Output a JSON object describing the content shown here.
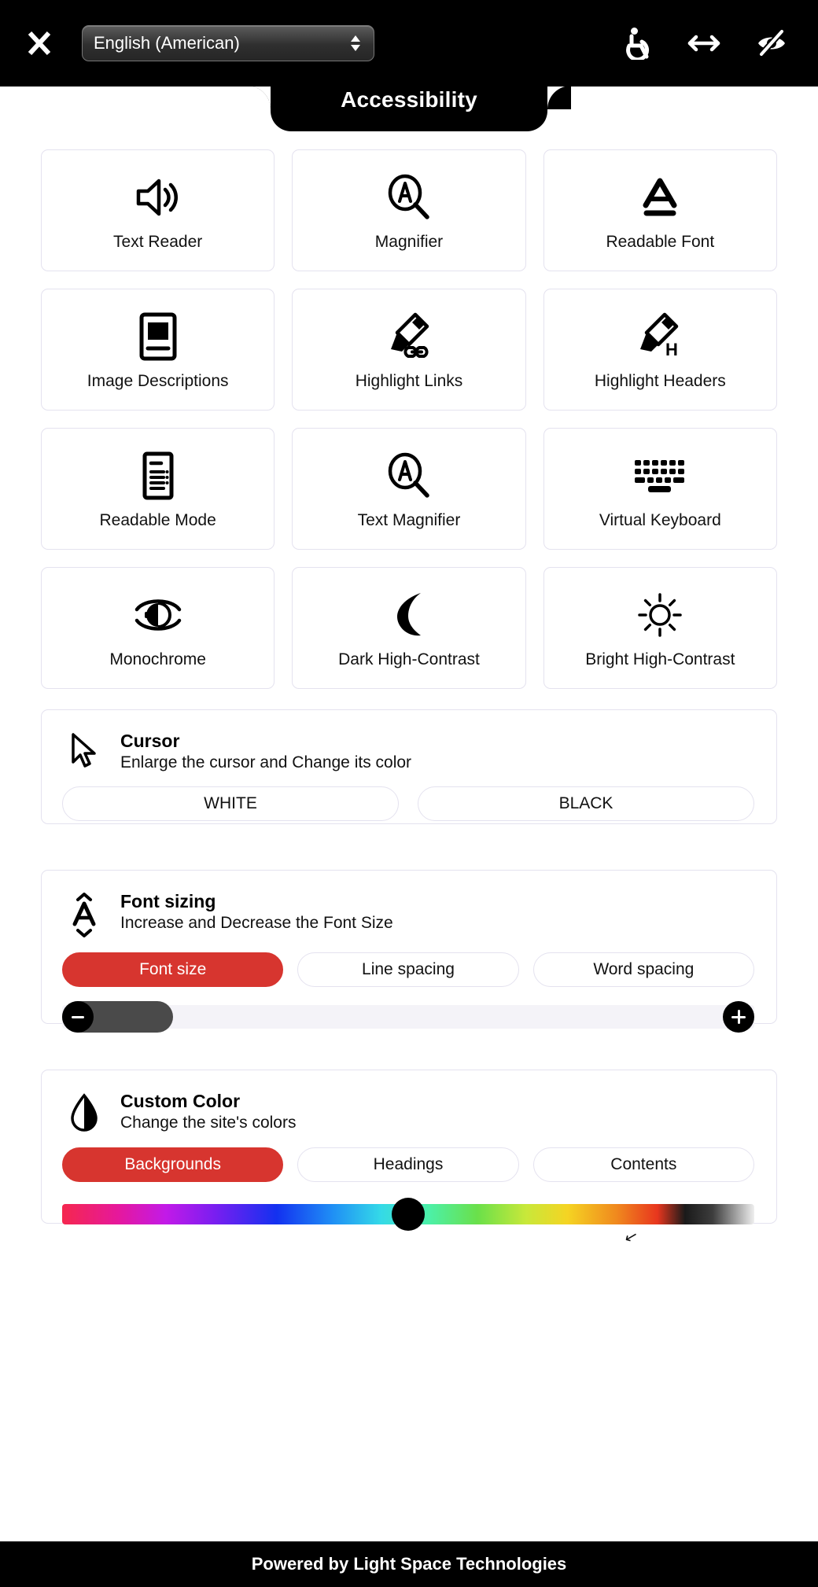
{
  "header": {
    "close_icon": "close-x-icon",
    "language_value": "English (American)",
    "actions": [
      {
        "name": "accessibility-wheelchair-icon"
      },
      {
        "name": "resize-horizontal-icon"
      },
      {
        "name": "hide-eye-off-icon"
      }
    ]
  },
  "title": "Accessibility",
  "tiles": [
    {
      "label": "Text Reader",
      "icon": "speaker-volume-icon"
    },
    {
      "label": "Magnifier",
      "icon": "magnifier-a-icon"
    },
    {
      "label": "Readable Font",
      "icon": "letter-a-underline-icon"
    },
    {
      "label": "Image Descriptions",
      "icon": "image-frame-icon"
    },
    {
      "label": "Highlight Links",
      "icon": "highlighter-link-icon"
    },
    {
      "label": "Highlight Headers",
      "icon": "highlighter-h-icon"
    },
    {
      "label": "Readable Mode",
      "icon": "document-lines-icon"
    },
    {
      "label": "Text Magnifier",
      "icon": "magnifier-a-icon"
    },
    {
      "label": "Virtual Keyboard",
      "icon": "keyboard-icon"
    },
    {
      "label": "Monochrome",
      "icon": "eye-half-icon"
    },
    {
      "label": "Dark High-Contrast",
      "icon": "moon-icon"
    },
    {
      "label": "Bright High-Contrast",
      "icon": "sun-icon"
    }
  ],
  "cursor_panel": {
    "icon": "cursor-arrow-icon",
    "title": "Cursor",
    "subtitle": "Enlarge the cursor and Change its color",
    "buttons": [
      {
        "label": "WHITE",
        "active": false
      },
      {
        "label": "BLACK",
        "active": false
      }
    ]
  },
  "font_panel": {
    "icon": "font-sizing-a-icon",
    "title": "Font sizing",
    "subtitle": "Increase and Decrease the Font Size",
    "tabs": [
      {
        "label": "Font size",
        "active": true
      },
      {
        "label": "Line spacing",
        "active": false
      },
      {
        "label": "Word spacing",
        "active": false
      }
    ],
    "slider": {
      "decrease_icon": "minus-icon",
      "increase_icon": "plus-icon",
      "fill_percent": 16
    }
  },
  "color_panel": {
    "icon": "color-drop-icon",
    "title": "Custom Color",
    "subtitle": "Change the site's colors",
    "tabs": [
      {
        "label": "Backgrounds",
        "active": true
      },
      {
        "label": "Headings",
        "active": false
      },
      {
        "label": "Contents",
        "active": false
      }
    ],
    "gradient_thumb_percent": 50,
    "caret_glyph": "↙"
  },
  "footer": "Powered by Light Space Technologies",
  "colors": {
    "accent_red": "#d7352f",
    "black": "#000000",
    "tile_border": "#e4e2ef",
    "slider_track": "#f4f3f8",
    "slider_fill": "#4a4a4a"
  }
}
